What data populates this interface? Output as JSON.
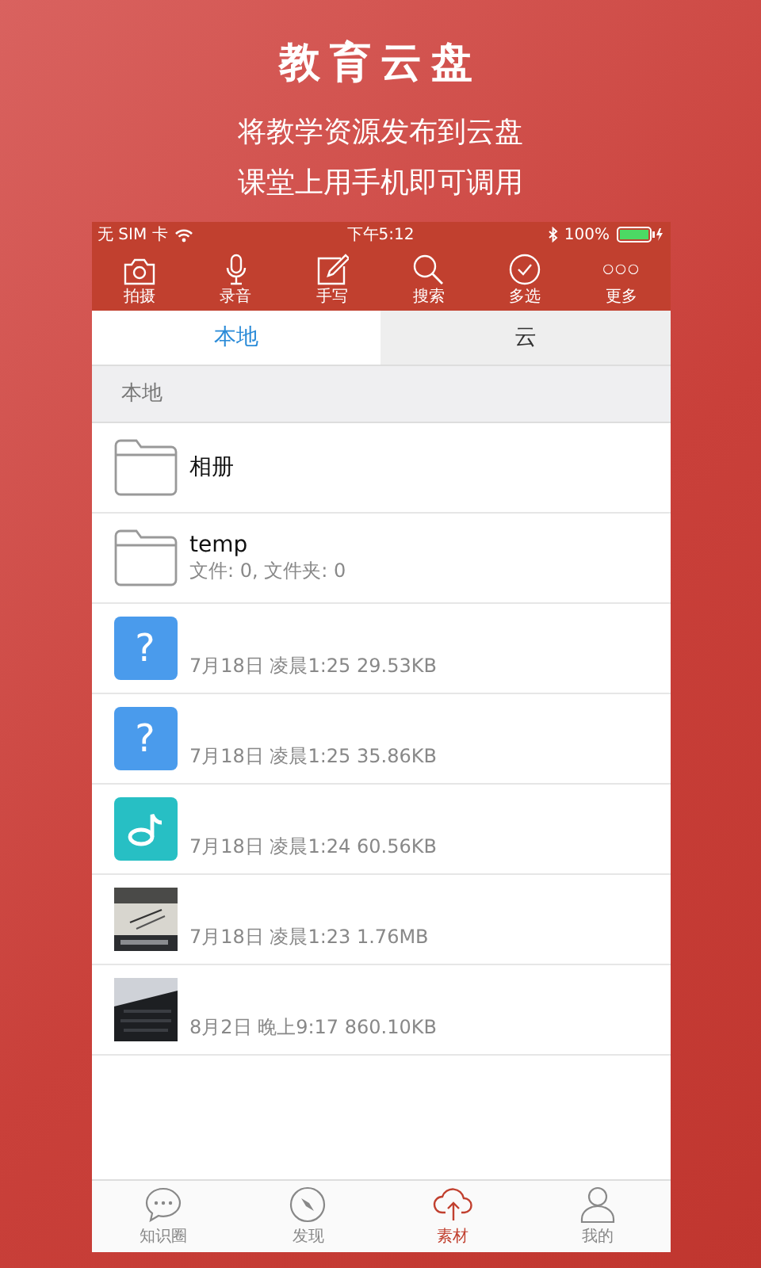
{
  "headline": "教育云盘",
  "subtitle_lines": [
    "将教学资源发布到云盘",
    "课堂上用手机即可调用"
  ],
  "status_bar": {
    "carrier": "无 SIM 卡",
    "time": "下午5:12",
    "battery": "100%"
  },
  "toolbar": [
    {
      "kind": "camera",
      "label": "拍摄"
    },
    {
      "kind": "mic",
      "label": "录音"
    },
    {
      "kind": "pen",
      "label": "手写"
    },
    {
      "kind": "search",
      "label": "搜索"
    },
    {
      "kind": "check",
      "label": "多选"
    },
    {
      "kind": "more",
      "label": "更多",
      "glyph": "○○○"
    }
  ],
  "tabs": [
    {
      "label": "本地",
      "selected": true
    },
    {
      "label": "云",
      "selected": false
    }
  ],
  "section_header": "本地",
  "files": [
    {
      "kind": "folder",
      "name": "相册"
    },
    {
      "kind": "folder",
      "name": "temp",
      "detail": "文件: 0, 文件夹: 0"
    },
    {
      "kind": "unknown",
      "glyph": "?",
      "detail": "7月18日 凌晨1:25 29.53KB"
    },
    {
      "kind": "unknown",
      "glyph": "?",
      "detail": "7月18日 凌晨1:25 35.86KB"
    },
    {
      "kind": "audio",
      "detail": "7月18日 凌晨1:24 60.56KB"
    },
    {
      "detail": "7月18日 凌晨1:23 1.76MB"
    },
    {
      "detail": "8月2日 晚上9:17 860.10KB"
    }
  ],
  "bottom_nav": [
    {
      "kind": "chat",
      "label": "知识圈",
      "selected": false
    },
    {
      "kind": "compass",
      "label": "发现",
      "selected": false
    },
    {
      "kind": "cloud",
      "label": "素材",
      "selected": true
    },
    {
      "kind": "person",
      "label": "我的",
      "selected": false
    }
  ]
}
